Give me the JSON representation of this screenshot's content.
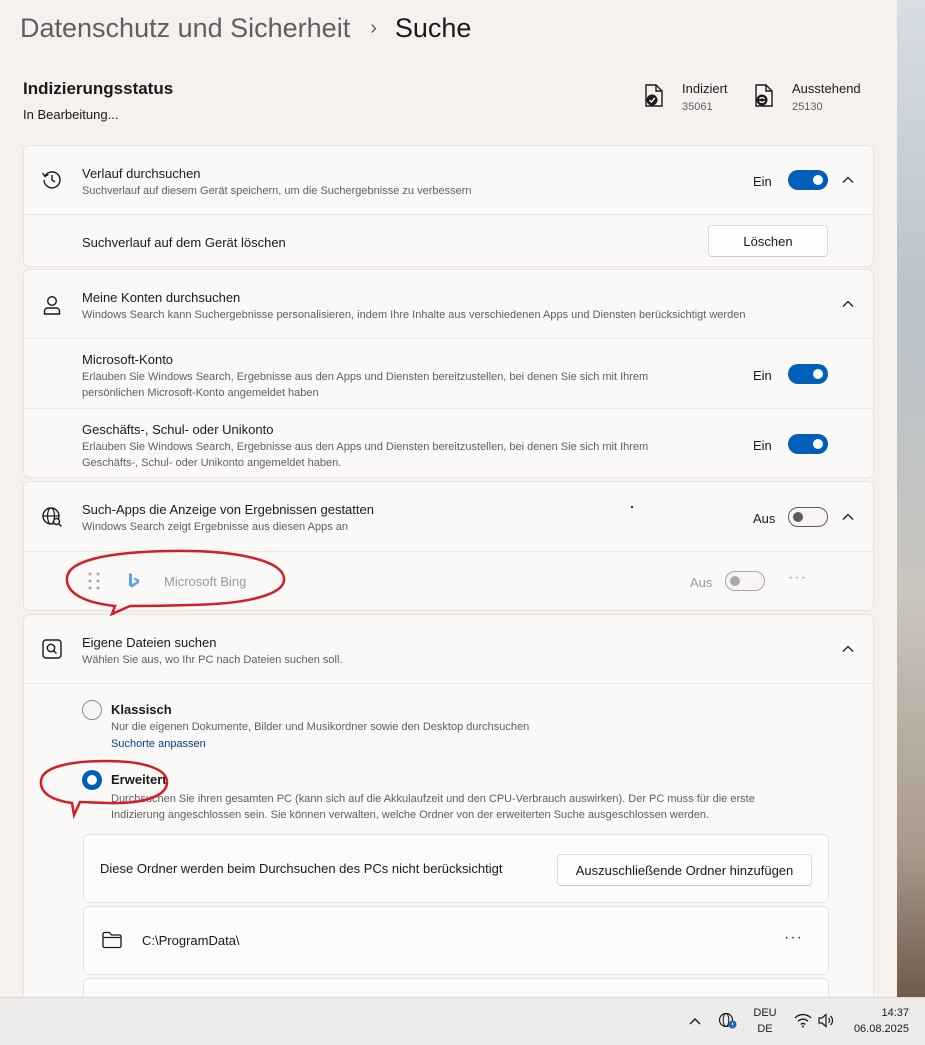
{
  "breadcrumb": {
    "parent": "Datenschutz und Sicherheit",
    "separator": "›",
    "current": "Suche"
  },
  "indexing": {
    "title": "Indizierungsstatus",
    "status": "In Bearbeitung...",
    "indexed_label": "Indiziert",
    "indexed_value": "35061",
    "pending_label": "Ausstehend",
    "pending_value": "25130"
  },
  "history": {
    "title": "Verlauf durchsuchen",
    "desc": "Suchverlauf auf diesem Gerät speichern, um die Suchergebnisse zu verbessern",
    "state": "Ein",
    "toggle_on": true,
    "clear_label": "Suchverlauf auf dem Gerät löschen",
    "clear_button": "Löschen"
  },
  "accounts": {
    "title": "Meine Konten durchsuchen",
    "desc": "Windows Search kann Suchergebnisse personalisieren, indem Ihre Inhalte aus verschiedenen Apps und Diensten berücksichtigt werden",
    "microsoft": {
      "title": "Microsoft-Konto",
      "desc_line1": "Erlauben Sie Windows Search, Ergebnisse aus den Apps und Diensten bereitzustellen, bei denen Sie sich mit Ihrem",
      "desc_line2": "persönlichen Microsoft-Konto angemeldet haben",
      "state": "Ein",
      "toggle_on": true
    },
    "work": {
      "title": "Geschäfts-, Schul- oder Unikonto",
      "desc_line1": "Erlauben Sie Windows Search, Ergebnisse aus den Apps und Diensten bereitzustellen, bei denen Sie sich mit Ihrem",
      "desc_line2": "Geschäfts-, Schul- oder Unikonto angemeldet haben.",
      "state": "Ein",
      "toggle_on": true
    }
  },
  "apps": {
    "title": "Such-Apps die Anzeige von Ergebnissen gestatten",
    "desc": "Windows Search zeigt Ergebnisse aus diesen Apps an",
    "state": "Aus",
    "toggle_on": false,
    "bing": {
      "label": "Microsoft Bing",
      "state": "Aus",
      "toggle_on": false,
      "more": "···"
    }
  },
  "files": {
    "title": "Eigene Dateien suchen",
    "desc": "Wählen Sie aus, wo Ihr PC nach Dateien suchen soll.",
    "classic": {
      "title": "Klassisch",
      "desc": "Nur die eigenen Dokumente, Bilder und Musikordner sowie den Desktop durchsuchen",
      "link": "Suchorte anpassen",
      "selected": false
    },
    "enhanced": {
      "title": "Erweitert",
      "desc_line1": "Durchsuchen Sie ihren gesamten PC (kann sich auf die Akkulaufzeit und den CPU-Verbrauch auswirken). Der PC muss für die erste",
      "desc_line2": "Indizierung angeschlossen sein. Sie können verwalten, welche Ordner von der erweiterten Suche ausgeschlossen werden.",
      "selected": true
    },
    "excluded": {
      "label": "Diese Ordner werden beim Durchsuchen des PCs nicht berücksichtigt",
      "add_button": "Auszuschließende Ordner hinzufügen",
      "folders": [
        "C:\\ProgramData\\"
      ],
      "more": "···"
    }
  },
  "taskbar": {
    "lang_top": "DEU",
    "lang_bottom": "DE",
    "time": "14:37",
    "date": "06.08.2025"
  },
  "colors": {
    "accent": "#005fb8",
    "annotation": "#d0202a"
  }
}
